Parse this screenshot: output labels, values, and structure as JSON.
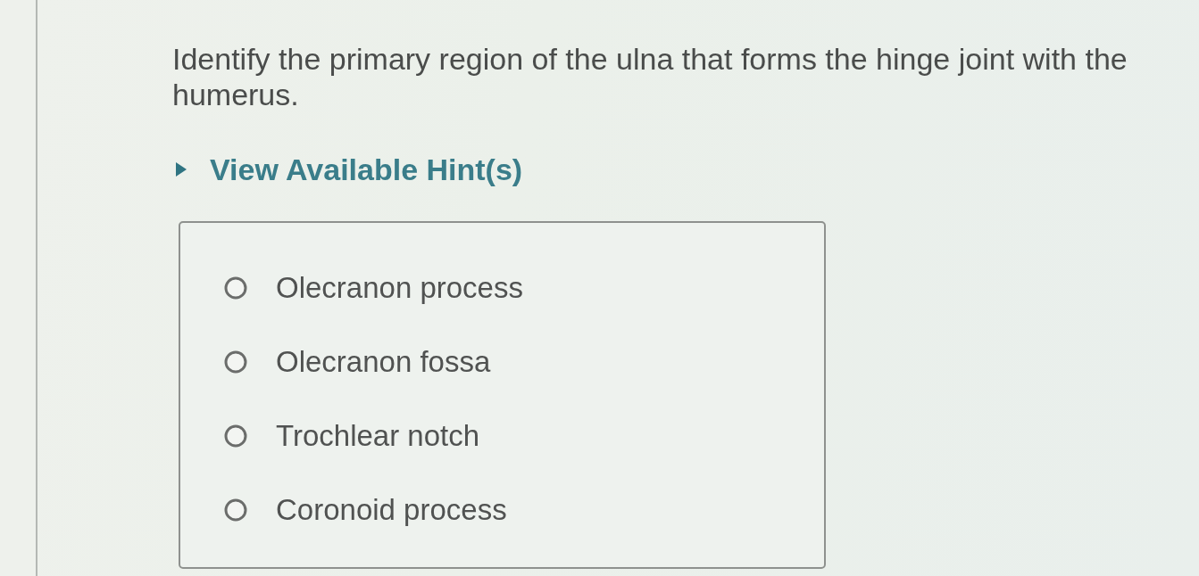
{
  "question": {
    "text": "Identify the primary region of the ulna that forms the hinge joint with the humerus."
  },
  "hint": {
    "label": "View Available Hint(s)",
    "expanded": false
  },
  "answers": [
    {
      "label": "Olecranon process",
      "selected": false
    },
    {
      "label": "Olecranon fossa",
      "selected": false
    },
    {
      "label": "Trochlear notch",
      "selected": false
    },
    {
      "label": "Coronoid process",
      "selected": false
    }
  ]
}
